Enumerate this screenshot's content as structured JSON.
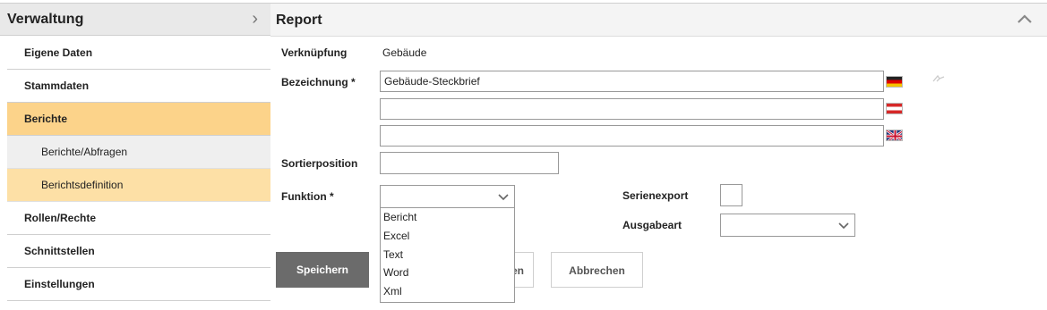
{
  "sidebar": {
    "title": "Verwaltung",
    "items": {
      "eigene_daten": "Eigene Daten",
      "stammdaten": "Stammdaten",
      "berichte": "Berichte",
      "berichte_abfragen": "Berichte/Abfragen",
      "berichtsdefinition": "Berichtsdefinition",
      "rollen_rechte": "Rollen/Rechte",
      "schnittstellen": "Schnittstellen",
      "einstellungen": "Einstellungen"
    }
  },
  "main": {
    "title": "Report",
    "verknuepfung_label": "Verknüpfung",
    "verknuepfung_value": "Gebäude",
    "bezeichnung_label": "Bezeichnung *",
    "bezeichnung_de": "Gebäude-Steckbrief",
    "bezeichnung_at": "",
    "bezeichnung_gb": "",
    "sortierposition_label": "Sortierposition",
    "sortierposition_value": "",
    "funktion_label": "Funktion *",
    "funktion_value": "",
    "funktion_options": [
      "Bericht",
      "Excel",
      "Text",
      "Word",
      "Xml"
    ],
    "serienexport_label": "Serienexport",
    "ausgabeart_label": "Ausgabeart",
    "ausgabeart_value": ""
  },
  "buttons": {
    "save": "Speichern",
    "hidden_partial": "en",
    "cancel": "Abbrechen"
  },
  "colors": {
    "active_item": "#fcd38a",
    "sub_item_highlight": "#fde0a6",
    "primary_button": "#6b6b6b"
  },
  "icons": [
    "chevron-right-icon",
    "chevron-up-icon",
    "chevron-down-icon",
    "flag-de-icon",
    "flag-at-icon",
    "flag-gb-icon",
    "translate-icon"
  ]
}
